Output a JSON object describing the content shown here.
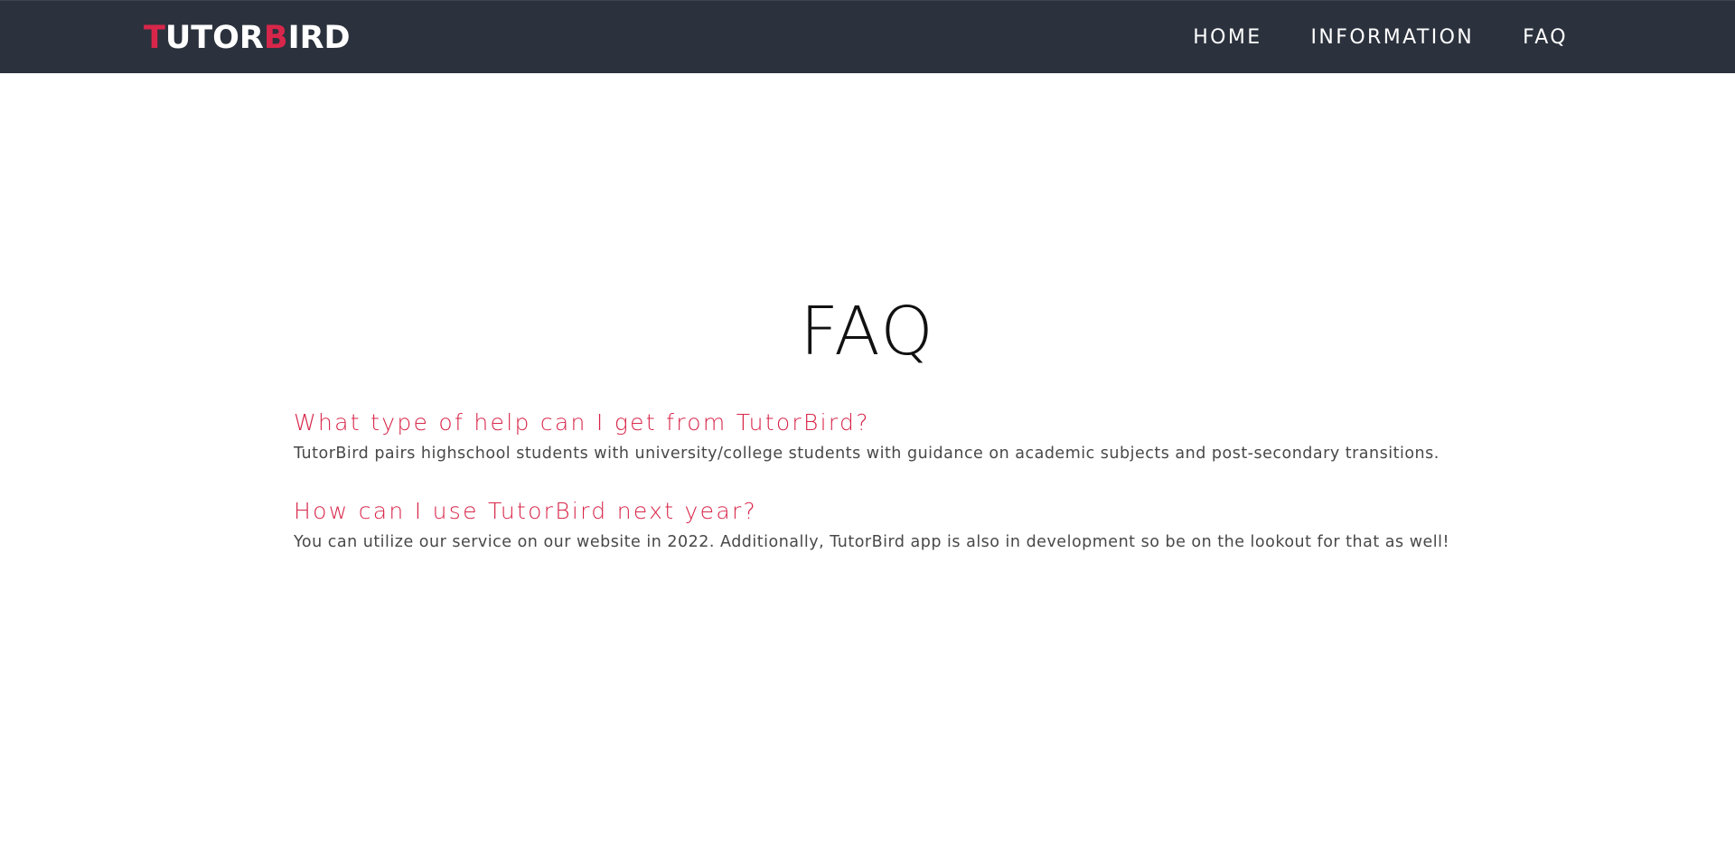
{
  "header": {
    "logo": {
      "parts": [
        {
          "text": "T",
          "accent": true
        },
        {
          "text": "UTOR",
          "accent": false
        },
        {
          "text": "B",
          "accent": true
        },
        {
          "text": "IRD",
          "accent": false
        }
      ]
    },
    "nav": [
      {
        "label": "HOME"
      },
      {
        "label": "INFORMATION"
      },
      {
        "label": "FAQ"
      }
    ]
  },
  "main": {
    "title": "FAQ",
    "faqs": [
      {
        "question": "What type of help can I get from TutorBird?",
        "answer": "TutorBird pairs highschool students with university/college students with guidance on academic subjects and post-secondary transitions."
      },
      {
        "question": "How can I use TutorBird next year?",
        "answer": "You can utilize our service on our website in 2022. Additionally, TutorBird app is also in development so be on the lookout for that as well!"
      }
    ]
  },
  "colors": {
    "navbar_bg": "#2b323d",
    "accent": "#d8264a",
    "nav_text": "#ffffff",
    "title_text": "#111111",
    "body_text": "#484848"
  }
}
